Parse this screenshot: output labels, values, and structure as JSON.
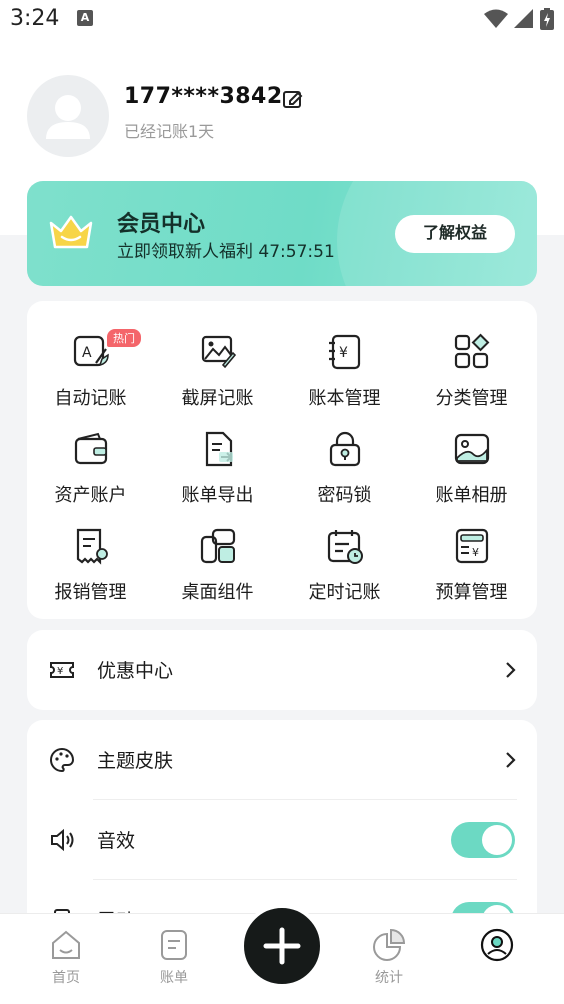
{
  "status_bar": {
    "time": "3:24",
    "notification_icon": "A"
  },
  "profile": {
    "username": "177****3842",
    "subtitle": "已经记账1天"
  },
  "vip": {
    "title": "会员中心",
    "subtitle": "立即领取新人福利 47:57:51",
    "button": "了解权益"
  },
  "tools": {
    "hot_badge": "热门",
    "items": [
      {
        "label": "自动记账",
        "icon": "auto-bookkeeping-icon"
      },
      {
        "label": "截屏记账",
        "icon": "screenshot-bookkeeping-icon"
      },
      {
        "label": "账本管理",
        "icon": "ledger-management-icon"
      },
      {
        "label": "分类管理",
        "icon": "category-management-icon"
      },
      {
        "label": "资产账户",
        "icon": "wallet-icon"
      },
      {
        "label": "账单导出",
        "icon": "export-icon"
      },
      {
        "label": "密码锁",
        "icon": "lock-icon"
      },
      {
        "label": "账单相册",
        "icon": "photo-album-icon"
      },
      {
        "label": "报销管理",
        "icon": "reimbursement-icon"
      },
      {
        "label": "桌面组件",
        "icon": "widget-icon"
      },
      {
        "label": "定时记账",
        "icon": "scheduled-bookkeeping-icon"
      },
      {
        "label": "预算管理",
        "icon": "budget-icon"
      }
    ]
  },
  "coupon": {
    "label": "优惠中心"
  },
  "settings": {
    "theme": "主题皮肤",
    "sound": "音效",
    "vibration": "震动"
  },
  "bottom_nav": {
    "home": "首页",
    "bills": "账单",
    "stats": "统计"
  },
  "colors": {
    "accent": "#6cd9c3",
    "hot": "#f4656a",
    "fab": "#161a19"
  }
}
